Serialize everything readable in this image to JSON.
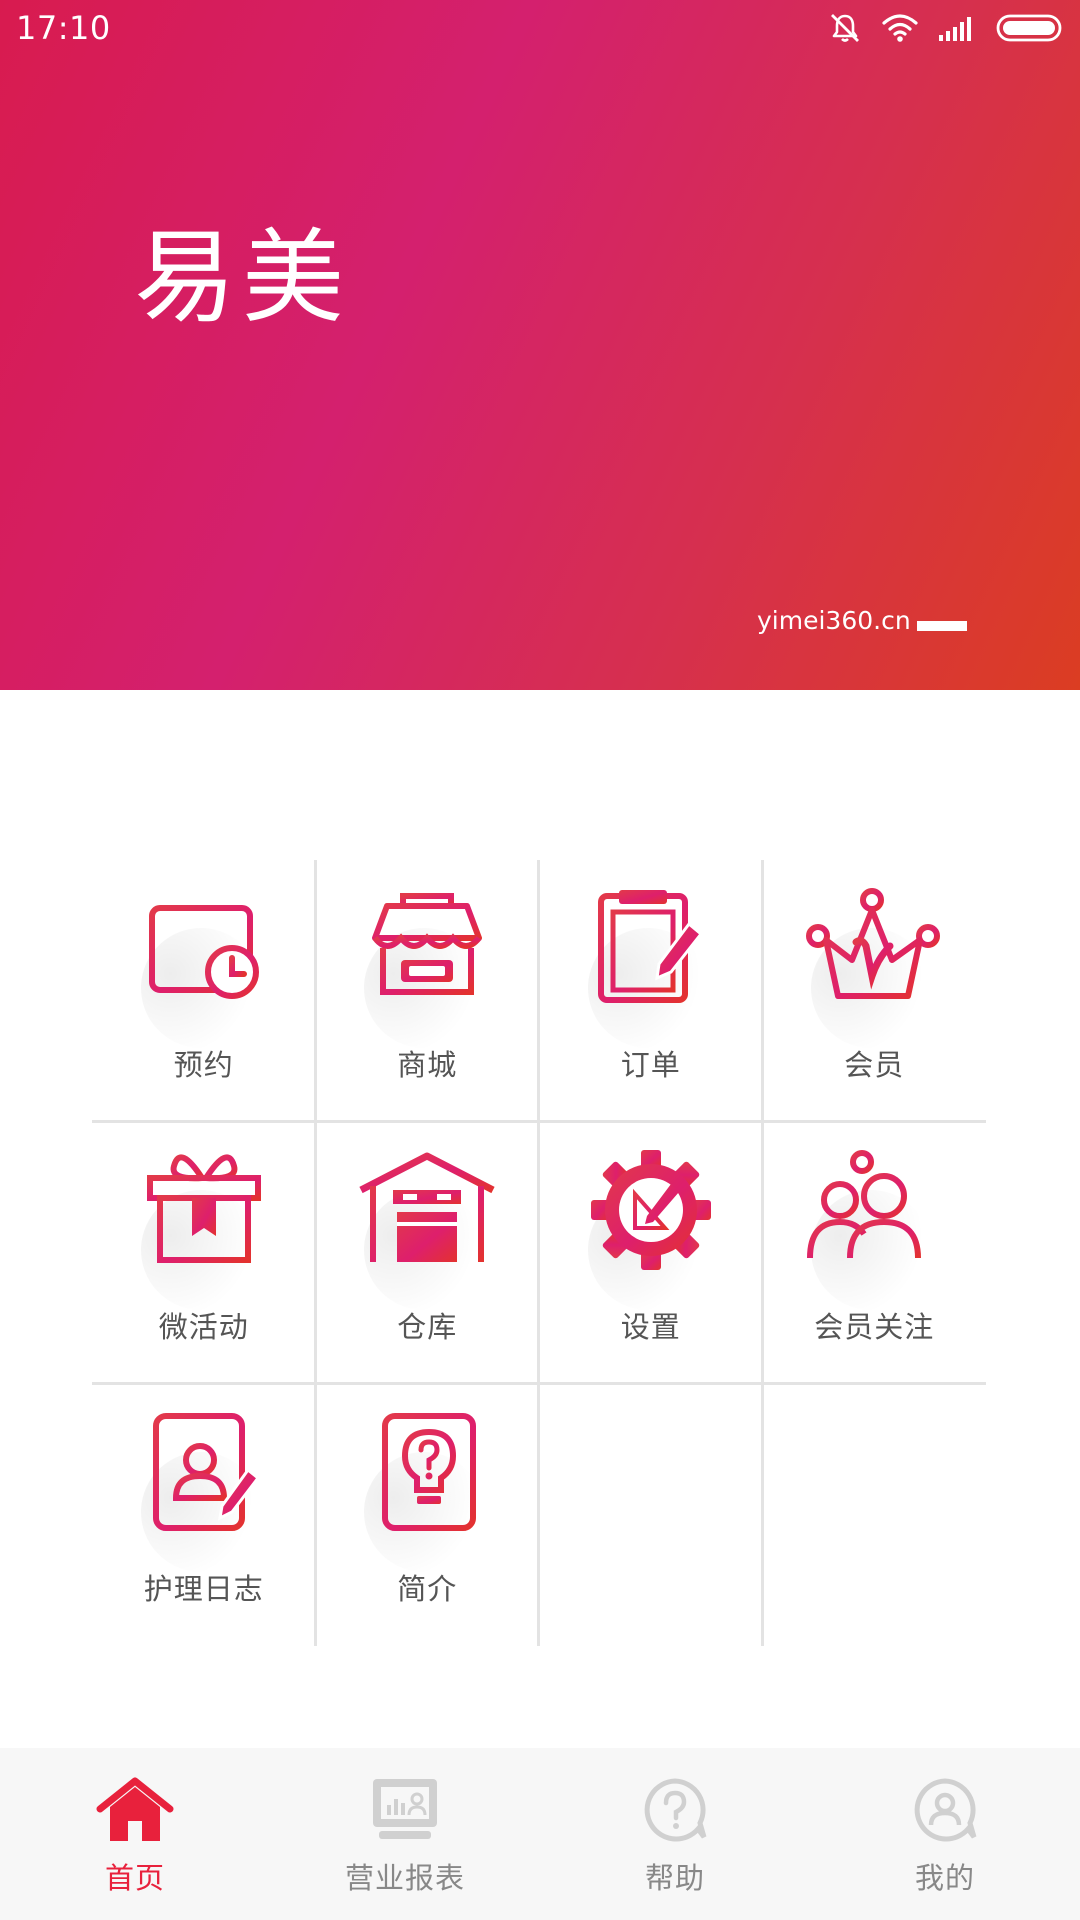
{
  "status_bar": {
    "time": "17:10",
    "icons": [
      "mute-icon",
      "wifi-icon",
      "signal-icon",
      "battery-icon"
    ]
  },
  "banner": {
    "title": "易美",
    "url": "yimei360.cn",
    "gradient_colors": [
      "#d81b4f",
      "#d4206e",
      "#d62f4f",
      "#db3d22"
    ]
  },
  "menu": {
    "accent_color": "#e0215a",
    "items": [
      {
        "label": "预约",
        "icon": "calendar-clock-icon"
      },
      {
        "label": "商城",
        "icon": "store-icon"
      },
      {
        "label": "订单",
        "icon": "clipboard-order-icon"
      },
      {
        "label": "会员",
        "icon": "crown-vip-icon"
      },
      {
        "label": "微活动",
        "icon": "gift-box-icon"
      },
      {
        "label": "仓库",
        "icon": "warehouse-icon"
      },
      {
        "label": "设置",
        "icon": "gear-icon"
      },
      {
        "label": "会员关注",
        "icon": "add-members-icon"
      },
      {
        "label": "护理日志",
        "icon": "contact-notebook-icon"
      },
      {
        "label": "简介",
        "icon": "lightbulb-notebook-icon"
      }
    ]
  },
  "bottom_nav": {
    "active_color": "#e8213c",
    "inactive_color": "#c8c8c8",
    "items": [
      {
        "label": "首页",
        "icon": "home-icon",
        "active": true
      },
      {
        "label": "营业报表",
        "icon": "report-monitor-icon",
        "active": false
      },
      {
        "label": "帮助",
        "icon": "help-bubble-icon",
        "active": false
      },
      {
        "label": "我的",
        "icon": "profile-bubble-icon",
        "active": false
      }
    ]
  }
}
